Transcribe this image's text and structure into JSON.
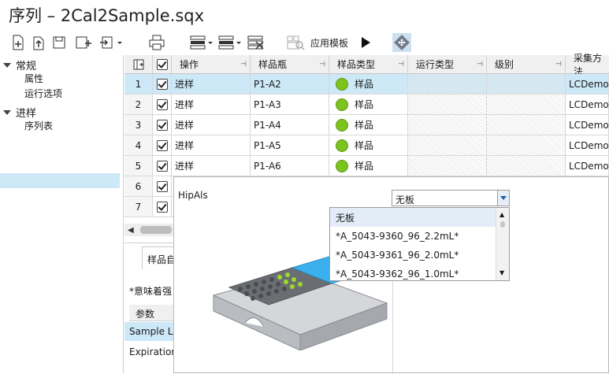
{
  "window": {
    "title": "序列 – 2Cal2Sample.sqx"
  },
  "toolbar": {
    "apply_template_label": "应用模板",
    "icons": [
      "new-row-icon",
      "insert-above-icon",
      "save-icon",
      "add-plate-icon",
      "import-icon",
      "print-icon",
      "row-align-icon",
      "column-align-icon",
      "delete-icon",
      "template-icon",
      "run-icon",
      "plate-view-icon"
    ]
  },
  "nav": {
    "groups": [
      {
        "label": "常规",
        "items": [
          "属性",
          "运行选项"
        ]
      },
      {
        "label": "进样",
        "items": [
          "序列表"
        ]
      }
    ],
    "selected": "序列表"
  },
  "table": {
    "columns": [
      "操作",
      "样品瓶",
      "样品类型",
      "运行类型",
      "级别",
      "采集方法"
    ],
    "rows": [
      {
        "num": "1",
        "action": "进样",
        "vial": "P1-A2",
        "type": "样品",
        "method": "LCDemo.a"
      },
      {
        "num": "2",
        "action": "进样",
        "vial": "P1-A3",
        "type": "样品",
        "method": "LCDemo.a"
      },
      {
        "num": "3",
        "action": "进样",
        "vial": "P1-A4",
        "type": "样品",
        "method": "LCDemo.a"
      },
      {
        "num": "4",
        "action": "进样",
        "vial": "P1-A5",
        "type": "样品",
        "method": "LCDemo.a"
      },
      {
        "num": "5",
        "action": "进样",
        "vial": "P1-A6",
        "type": "样品",
        "method": "LCDemo.a"
      },
      {
        "num": "6"
      },
      {
        "num": "7"
      }
    ],
    "sample_color": "#7dc31e"
  },
  "bottom_panel": {
    "tab_label": "样品自",
    "note": "*意味着强",
    "params_header": "参数",
    "items": [
      "Sample Lo",
      "Expiration"
    ]
  },
  "plate_popup": {
    "module": "HipAls",
    "plate_selected": "无板",
    "options": [
      "无板",
      "*A_5043-9360_96_2.2mL*",
      "*A_5043-9361_96_2.0mL*",
      "*A_5043-9362_96_1.0mL*"
    ]
  }
}
